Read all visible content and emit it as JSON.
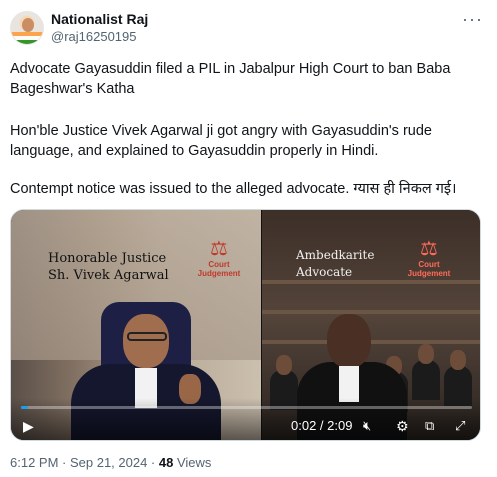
{
  "user": {
    "display_name": "Nationalist Raj",
    "handle": "@raj16250195",
    "more_icon": "more-dots-icon"
  },
  "tweet": {
    "paragraph_1": "Advocate Gayasuddin filed a PIL in Jabalpur High Court to ban Baba Bageshwar's Katha",
    "paragraph_2": "Hon'ble Justice Vivek Agarwal ji got angry with Gayasuddin's rude language, and explained to Gayasuddin properly in Hindi.",
    "paragraph_3": "Contempt notice was issued to the alleged advocate. ग्यास ही निकल गई।"
  },
  "media": {
    "left_caption_line1": "Honorable Justice",
    "left_caption_line2": "Sh. Vivek Agarwal",
    "right_caption_line1": "Ambedkarite",
    "right_caption_line2": "Advocate",
    "logo_text": "Court Judgement",
    "player": {
      "time": "0:02 / 2:09",
      "progress_fraction": 0.016,
      "play_icon": "play-icon",
      "volume_icon": "volume-muted-icon",
      "settings_icon": "gear-icon",
      "pip_icon": "picture-in-picture-icon",
      "fullscreen_icon": "fullscreen-icon"
    }
  },
  "meta": {
    "time_date": "6:12 PM · Sep 21, 2024 · ",
    "views_count": "48",
    "views_label": " Views"
  },
  "colors": {
    "accent": "#1d9bf0",
    "text_primary": "#0f1419",
    "text_secondary": "#536471"
  }
}
